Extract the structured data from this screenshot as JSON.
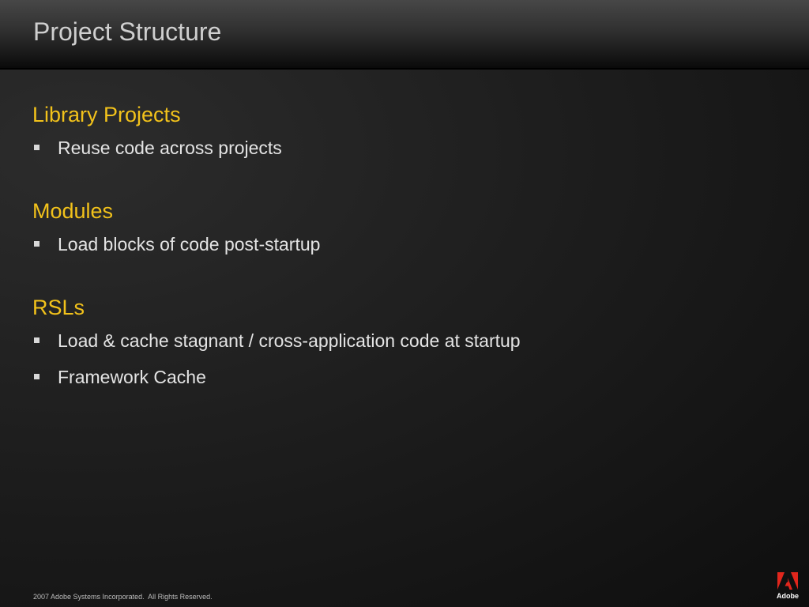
{
  "slide": {
    "title": "Project Structure"
  },
  "sections": [
    {
      "heading": "Library Projects",
      "bullets": [
        "Reuse code across projects"
      ]
    },
    {
      "heading": "Modules",
      "bullets": [
        "Load blocks of code post-startup"
      ]
    },
    {
      "heading": "RSLs",
      "bullets": [
        "Load & cache stagnant / cross-application code at startup",
        "Framework Cache"
      ]
    }
  ],
  "footer": {
    "copyright": "2007 Adobe Systems Incorporated.  All Rights Reserved.",
    "logo_text": "Adobe"
  },
  "colors": {
    "heading_accent": "#f2c21b",
    "logo_red": "#e1261c",
    "background": "#1e1e1e"
  },
  "icons": {
    "bullet": "square-bullet-icon",
    "logo": "adobe-logo-icon"
  }
}
